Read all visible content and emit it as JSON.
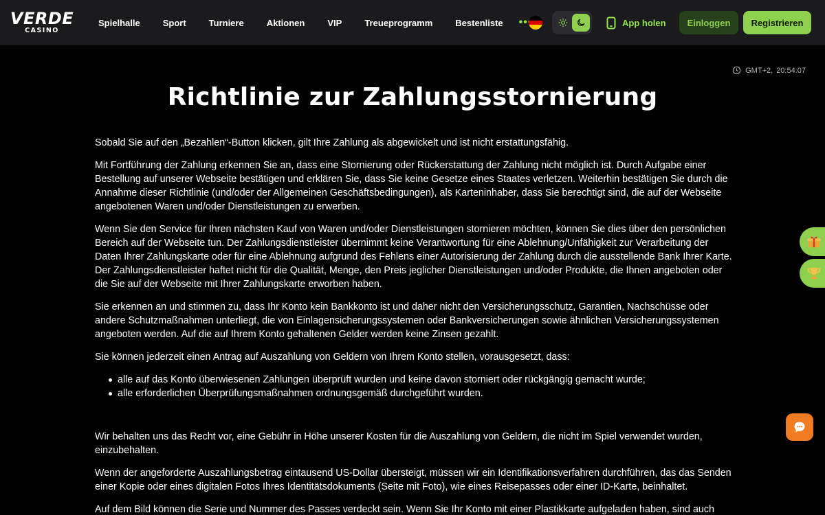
{
  "header": {
    "logo": {
      "main": "VERDE",
      "sub": "CASINO"
    },
    "nav": [
      "Spielhalle",
      "Sport",
      "Turniere",
      "Aktionen",
      "VIP",
      "Treueprogramm",
      "Bestenliste"
    ],
    "more": "•••",
    "language_icon": "germany-flag-icon",
    "theme": {
      "light_icon": "sun-icon",
      "dark_icon": "moon-icon",
      "active": "dark"
    },
    "app_link": {
      "label": "App holen",
      "icon": "phone-icon"
    },
    "login_label": "Einloggen",
    "register_label": "Registrieren",
    "colors": {
      "accent": "#8fd14f",
      "header_bg": "#1b1b1d",
      "login_bg": "#28411d",
      "chat": "#f27c22"
    }
  },
  "clock": {
    "timezone": "GMT+2,",
    "time": "20:54:07",
    "icon": "clock-icon"
  },
  "page": {
    "title": "Richtlinie zur Zahlungsstornierung",
    "paragraphs": [
      "Sobald Sie auf den „Bezahlen“-Button klicken, gilt Ihre Zahlung als abgewickelt und ist nicht erstattungsfähig.",
      "Mit Fortführung der Zahlung erkennen Sie an, dass eine Stornierung oder Rückerstattung der Zahlung nicht möglich ist. Durch Aufgabe einer Bestellung auf unserer Webseite bestätigen und erklären Sie, dass Sie keine Gesetze eines Staates verletzen. Weiterhin bestätigen Sie durch die Annahme dieser Richtlinie (und/oder der Allgemeinen Geschäftsbedingungen), als Karteninhaber, dass Sie berechtigt sind, die auf der Webseite angebotenen Waren und/oder Dienstleistungen zu erwerben.",
      "Wenn Sie den Service für Ihren nächsten Kauf von Waren und/oder Dienstleistungen stornieren möchten, können Sie dies über den persönlichen Bereich auf der Webseite tun. Der Zahlungsdienstleister übernimmt keine Verantwortung für eine Ablehnung/Unfähigkeit zur Verarbeitung der Daten Ihrer Zahlungskarte oder für eine Ablehnung aufgrund des Fehlens einer Autorisierung der Zahlung durch die ausstellende Bank Ihrer Karte. Der Zahlungsdienstleister haftet nicht für die Qualität, Menge, den Preis jeglicher Dienstleistungen und/oder Produkte, die Ihnen angeboten oder die Sie auf der Webseite mit Ihrer Zahlungskarte erworben haben.",
      "Sie erkennen an und stimmen zu, dass Ihr Konto kein Bankkonto ist und daher nicht den Versicherungsschutz, Garantien, Nachschüsse oder andere Schutzmaßnahmen unterliegt, die von Einlagensicherungssystemen oder Bankversicherungen sowie ähnlichen Versicherungssystemen angeboten werden. Auf die auf Ihrem Konto gehaltenen Gelder werden keine Zinsen gezahlt.",
      "Sie können jederzeit einen Antrag auf Auszahlung von Geldern von Ihrem Konto stellen, vorausgesetzt, dass:"
    ],
    "list": [
      "alle auf das Konto überwiesenen Zahlungen überprüft wurden und keine davon storniert oder rückgängig gemacht wurde;",
      "alle erforderlichen Überprüfungsmaßnahmen ordnungsgemäß durchgeführt wurden."
    ],
    "paragraphs_after": [
      "Wir behalten uns das Recht vor, eine Gebühr in Höhe unserer Kosten für die Auszahlung von Geldern, die nicht im Spiel verwendet wurden, einzubehalten.",
      "Wenn der angeforderte Auszahlungsbetrag eintausend US-Dollar übersteigt, müssen wir ein Identifikationsverfahren durchführen, das das Senden einer Kopie oder eines digitalen Fotos Ihres Identitätsdokuments (Seite mit Foto), wie eines Reisepasses oder einer ID-Karte, beinhaltet.",
      "Auf dem Bild können die Serie und Nummer des Passes verdeckt sein. Wenn Sie Ihr Konto mit einer Plastikkarte aufgeladen haben, sind auch"
    ]
  },
  "floating": {
    "side_buttons": [
      {
        "icon": "gift-box-icon"
      },
      {
        "icon": "trophy-icon"
      }
    ],
    "chat_icon": "chat-bubble-icon"
  }
}
